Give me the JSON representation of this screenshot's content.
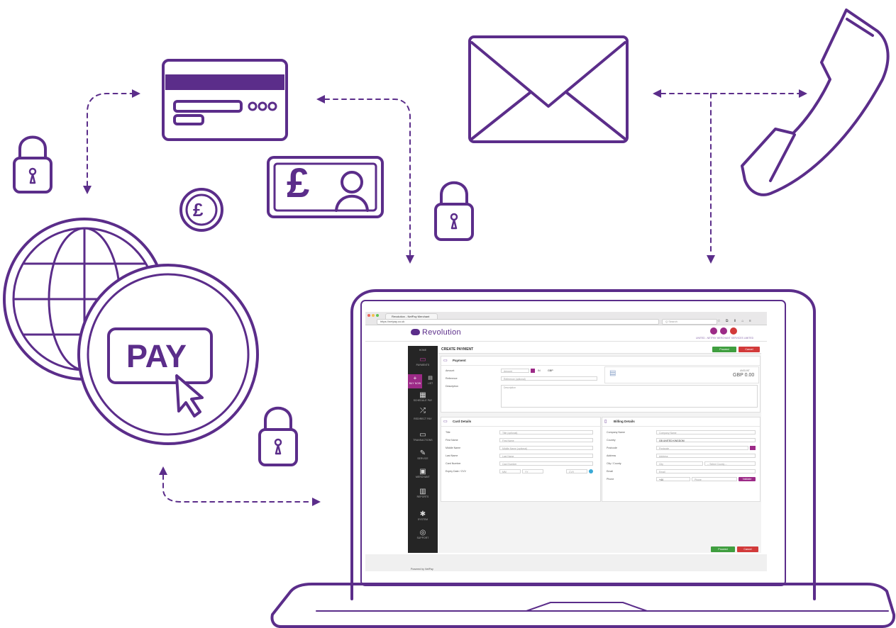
{
  "colors": {
    "brand": "#5b2d8a",
    "accent": "#9c2a87",
    "proceed": "#3f9e3f",
    "cancel": "#d23a3a",
    "sidebar": "#252525"
  },
  "illustration": {
    "pay_button": "PAY",
    "pound_symbol": "£",
    "icons": [
      "credit-card-icon",
      "banknote-icon",
      "pound-coin-icon",
      "envelope-icon",
      "telephone-handset-icon",
      "padlock-icon",
      "globe-icon",
      "cursor-icon",
      "laptop-icon"
    ]
  },
  "browser": {
    "tab_title": "Revolution - NetPay Merchant",
    "url": "https://netpay.co.uk",
    "search_placeholder": "Q Search"
  },
  "app": {
    "brand": "Revolution",
    "merchant_meta": "UNITED - NETPAY MERCHANT SERVICES LIMITED",
    "powered_by": "Powered by NetPay"
  },
  "sidebar": {
    "items": [
      {
        "label": "HOME",
        "icon": "home-icon"
      },
      {
        "label": "PAYMENTS",
        "icon": "payments-icon"
      },
      {
        "label": "BUY NOW",
        "icon": "plus-icon"
      },
      {
        "label": "LIST",
        "icon": "list-icon"
      },
      {
        "label": "SCHEDULE PAY",
        "icon": "calendar-icon"
      },
      {
        "label": "REDIRECT PAY",
        "icon": "shuffle-icon"
      },
      {
        "label": "TRANSACTIONS",
        "icon": "transactions-icon"
      },
      {
        "label": "SERVICE",
        "icon": "tag-icon"
      },
      {
        "label": "MERCHANT",
        "icon": "merchant-icon"
      },
      {
        "label": "REPORTS",
        "icon": "chart-icon"
      },
      {
        "label": "SYSTEM",
        "icon": "gear-icon"
      },
      {
        "label": "SUPPORT",
        "icon": "support-icon"
      }
    ]
  },
  "page": {
    "title": "CREATE PAYMENT",
    "proceed": "Proceed",
    "cancel": "Cancel"
  },
  "payment": {
    "heading": "Payment",
    "amount_label": "Amount",
    "amount_placeholder": "Amount",
    "in_label": "IN",
    "currency": "GBP",
    "reference_label": "Reference",
    "reference_placeholder": "Reference (optional)",
    "description_label": "Description",
    "description_placeholder": "Description",
    "amount_caption": "AMOUNT",
    "amount_display": "GBP 0.00"
  },
  "card": {
    "heading": "Card Details",
    "fields": [
      {
        "label": "Title",
        "placeholder": "Title (optional)"
      },
      {
        "label": "First Name",
        "placeholder": "First Name"
      },
      {
        "label": "Middle Name",
        "placeholder": "Middle Name (optional)"
      },
      {
        "label": "Last Name",
        "placeholder": "Last Name"
      },
      {
        "label": "Card Number",
        "placeholder": "Card Number"
      }
    ],
    "expiry_label": "Expiry Date / CVV",
    "expiry_month": "MM",
    "expiry_year": "YY",
    "cvv": "CVV"
  },
  "billing": {
    "heading": "Billing Details",
    "company_label": "Company Name",
    "company_placeholder": "Company Name",
    "country_label": "Country",
    "country_value": "GB UNITED KINGDOM",
    "postcode_label": "Postcode",
    "postcode_placeholder": "Postcode",
    "address_label": "Address",
    "address_placeholder": "Address",
    "city_label": "City / County",
    "city_placeholder": "City",
    "county_select": "-- Select County --",
    "email_label": "Email",
    "email_placeholder": "Email",
    "phone_label": "Phone",
    "phone_code": "+44",
    "phone_placeholder": "Phone",
    "validate": "Validate"
  }
}
